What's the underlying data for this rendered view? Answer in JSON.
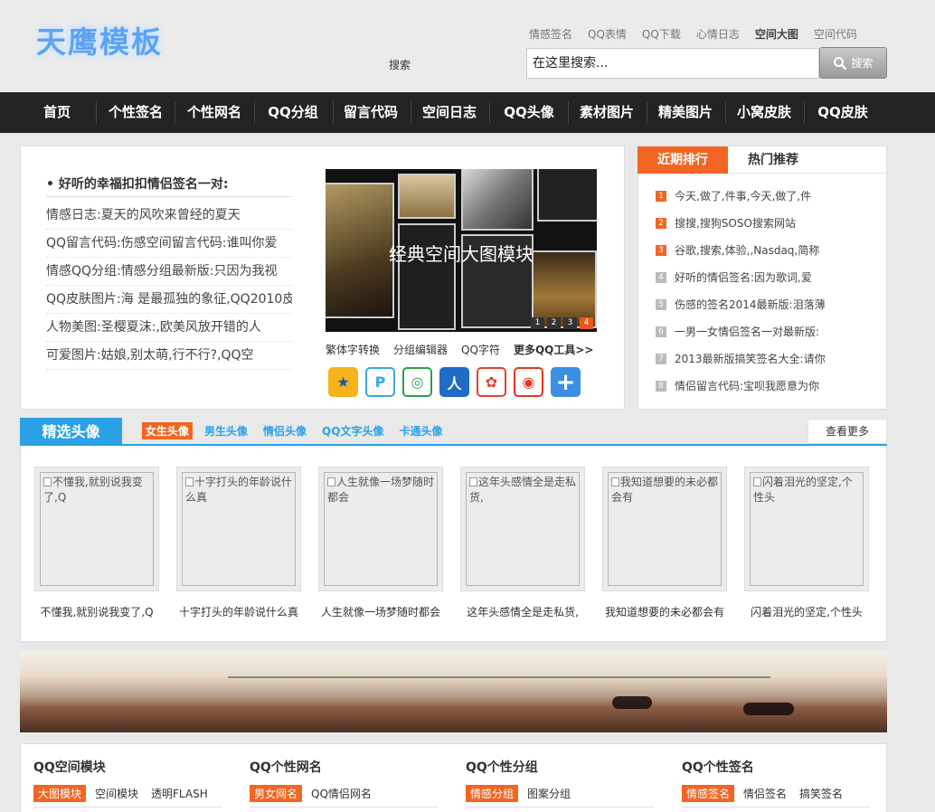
{
  "header": {
    "logo": "天鹰模板",
    "top_links": [
      "情感签名",
      "QQ表情",
      "QQ下载",
      "心情日志",
      "空间大图",
      "空间代码"
    ],
    "search_label": "搜索",
    "search_value": "在这里搜索...",
    "search_button": "搜索"
  },
  "nav": [
    "首页",
    "个性签名",
    "个性网名",
    "QQ分组",
    "留言代码",
    "空间日志",
    "QQ头像",
    "素材图片",
    "精美图片",
    "小窝皮肤",
    "QQ皮肤"
  ],
  "hot": {
    "title": "好听的幸福扣扣情侣签名一对:",
    "items": [
      "情感日志:夏天的风吹来曾经的夏天",
      "QQ留言代码:伤感空间留言代码:谁叫你爱",
      "情感QQ分组:情感分组最新版:只因为我视",
      "QQ皮肤图片:海 是最孤独的象征,QQ2010皮",
      "人物美图:圣樱夏沫:,欧美风放开错的人",
      "可爱图片:姑娘,别太萌,行不行?,QQ空"
    ]
  },
  "slider": {
    "caption": "经典空间大图模块",
    "dots": [
      "1",
      "2",
      "3",
      "4"
    ]
  },
  "tools": [
    "繁体字转换",
    "分组编辑器",
    "QQ字符",
    "更多QQ工具>>"
  ],
  "apps": [
    {
      "icon": "qzone-star-icon",
      "color": "#f5b41c",
      "glyph": "★"
    },
    {
      "icon": "qq-pinyin-icon",
      "color": "#39a7e2",
      "glyph": "P"
    },
    {
      "icon": "qq-browser-icon",
      "color": "#2e9e4a",
      "glyph": "◎"
    },
    {
      "icon": "renren-icon",
      "color": "#1f6bc6",
      "glyph": "人"
    },
    {
      "icon": "tencent-weibo-icon",
      "color": "#e0442f",
      "glyph": "✿"
    },
    {
      "icon": "sina-weibo-icon",
      "color": "#e4351d",
      "glyph": "◉"
    },
    {
      "icon": "add-more-icon",
      "color": "#3a8fe0",
      "glyph": "+"
    }
  ],
  "rank": {
    "tabs": [
      "近期排行",
      "热门推荐"
    ],
    "items": [
      {
        "num": "1",
        "text": "今天,做了,件事,今天,做了,件"
      },
      {
        "num": "2",
        "text": "搜搜,搜狗SOSO搜索网站"
      },
      {
        "num": "3",
        "text": "谷歌,搜索,体验,,Nasdaq,简称"
      },
      {
        "num": "4",
        "text": "好听的情侣签名:因为歌词,爱"
      },
      {
        "num": "5",
        "text": "伤感的签名2014最新版:泪落薄"
      },
      {
        "num": "6",
        "text": "一男一女情侣签名一对最新版:"
      },
      {
        "num": "7",
        "text": "2013最新版搞笑签名大全:请你"
      },
      {
        "num": "8",
        "text": "情侣留言代码:宝呗我愿意为你"
      }
    ]
  },
  "avatars": {
    "title": "精选头像",
    "tabs": [
      "女生头像",
      "男生头像",
      "情侣头像",
      "QQ文字头像",
      "卡通头像"
    ],
    "more": "查看更多",
    "items": [
      {
        "alt": "不懂我,就别说我变了,Q",
        "caption": "不懂我,就别说我变了,Q"
      },
      {
        "alt": "十字打头的年龄说什么真",
        "caption": "十字打头的年龄说什么真"
      },
      {
        "alt": "人生就像一场梦随时都会",
        "caption": "人生就像一场梦随时都会"
      },
      {
        "alt": "这年头感情全是走私货,",
        "caption": "这年头感情全是走私货,"
      },
      {
        "alt": "我知道想要的未必都会有",
        "caption": "我知道想要的未必都会有"
      },
      {
        "alt": "闪着泪光的坚定,个性头",
        "caption": "闪着泪光的坚定,个性头"
      }
    ]
  },
  "columns": [
    {
      "title": "QQ空间模块",
      "tags": [
        "大图模块",
        "空间模块",
        "透明FLASH"
      ]
    },
    {
      "title": "QQ个性网名",
      "tags": [
        "男女网名",
        "QQ情侣网名"
      ]
    },
    {
      "title": "QQ个性分组",
      "tags": [
        "情感分组",
        "图案分组"
      ]
    },
    {
      "title": "QQ个性签名",
      "tags": [
        "情感签名",
        "情侣签名",
        "搞笑签名"
      ]
    }
  ],
  "colors": {
    "accent_orange": "#f26522",
    "accent_blue": "#2ba1e5",
    "nav_bg": "#232323"
  }
}
